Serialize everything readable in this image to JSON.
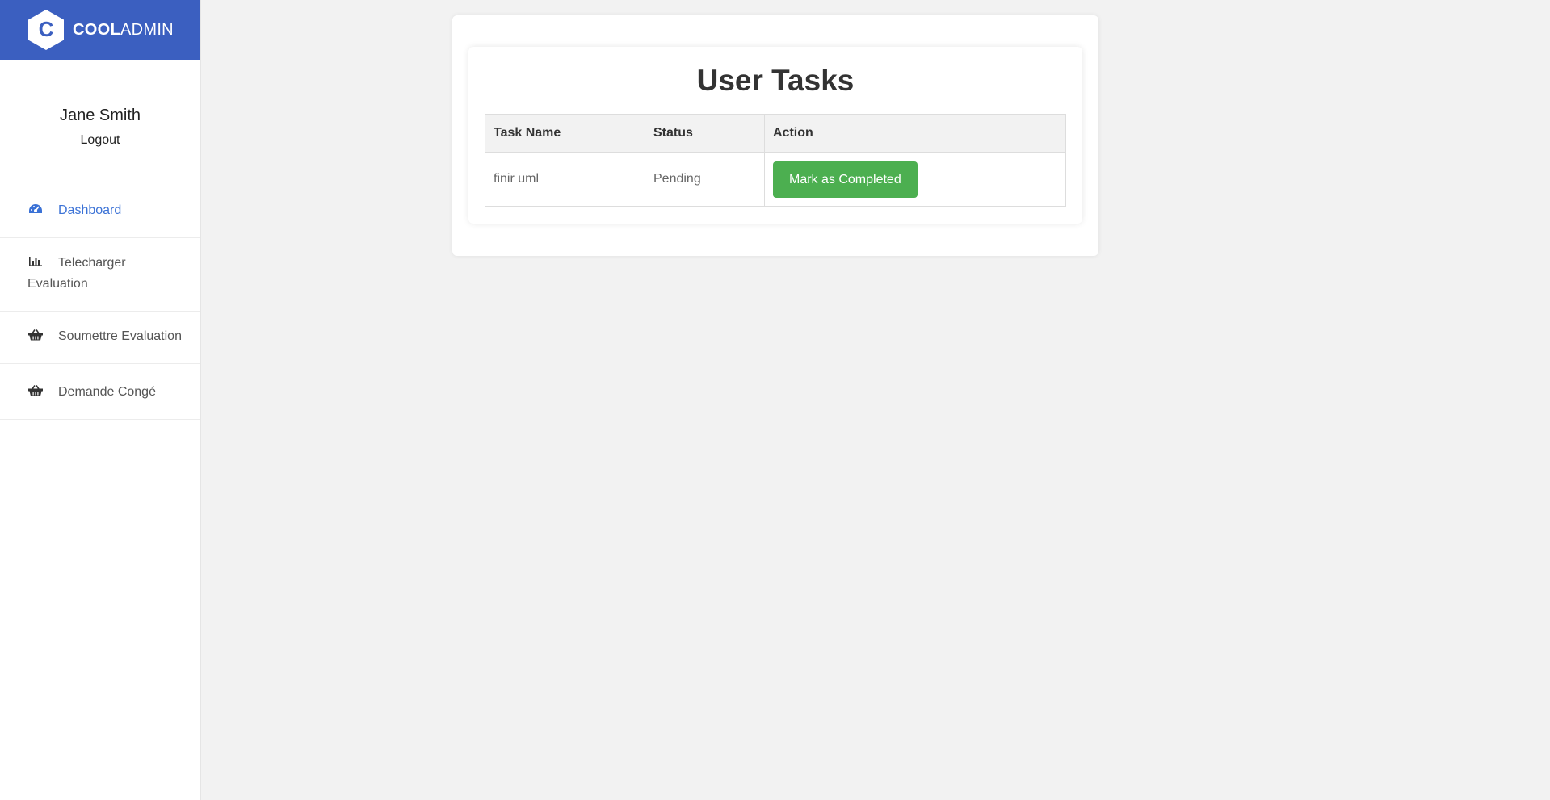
{
  "brand": {
    "bold": "COOL",
    "light": "ADMIN",
    "logo_letter": "C",
    "color": "#3b5fc0"
  },
  "user": {
    "name": "Jane Smith",
    "logout": "Logout"
  },
  "sidebar": {
    "items": [
      {
        "label": "Dashboard",
        "icon": "dashboard-gauge-icon",
        "active": true
      },
      {
        "label": "Telecharger Evaluation",
        "icon": "bar-chart-icon"
      },
      {
        "label": "Soumettre Evaluation",
        "icon": "basket-icon"
      },
      {
        "label": "Demande Congé",
        "icon": "basket-icon"
      }
    ]
  },
  "main": {
    "title": "User Tasks",
    "table": {
      "headers": [
        "Task Name",
        "Status",
        "Action"
      ],
      "rows": [
        {
          "task": "finir uml",
          "status": "Pending",
          "action": "Mark as Completed"
        }
      ]
    }
  },
  "colors": {
    "accent": "#3b72d6",
    "success": "#4caf50"
  }
}
